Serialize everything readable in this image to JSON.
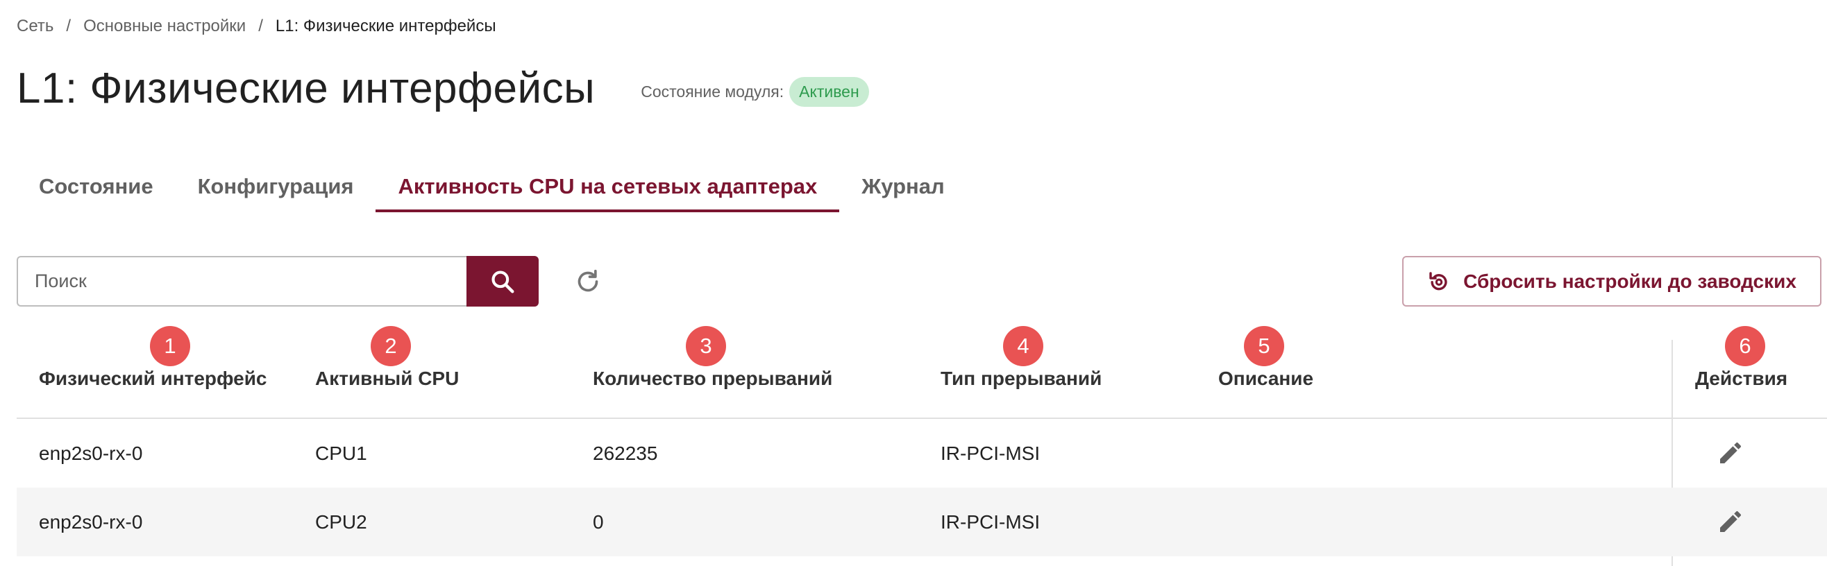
{
  "breadcrumb": {
    "items": [
      "Сеть",
      "Основные настройки",
      "L1: Физические интерфейсы"
    ],
    "separator": "/"
  },
  "page": {
    "title": "L1: Физические интерфейсы",
    "module_state_label": "Состояние модуля:",
    "module_state_value": "Активен"
  },
  "tabs": [
    {
      "label": "Состояние",
      "active": false
    },
    {
      "label": "Конфигурация",
      "active": false
    },
    {
      "label": "Активность CPU на сетевых адаптерах",
      "active": true
    },
    {
      "label": "Журнал",
      "active": false
    }
  ],
  "toolbar": {
    "search_placeholder": "Поиск",
    "search_icon": "search-icon",
    "refresh_icon": "refresh-icon",
    "reset_label": "Сбросить настройки до заводских",
    "reset_icon": "restore-settings-icon"
  },
  "table": {
    "columns": [
      {
        "badge": "1",
        "label": "Физический интерфейс"
      },
      {
        "badge": "2",
        "label": "Активный CPU"
      },
      {
        "badge": "3",
        "label": "Количество прерываний"
      },
      {
        "badge": "4",
        "label": "Тип прерываний"
      },
      {
        "badge": "5",
        "label": "Описание"
      },
      {
        "badge": "6",
        "label": "Действия"
      }
    ],
    "rows": [
      {
        "interface": "enp2s0-rx-0",
        "cpu": "CPU1",
        "interrupts": "262235",
        "type": "IR-PCI-MSI",
        "description": ""
      },
      {
        "interface": "enp2s0-rx-0",
        "cpu": "CPU2",
        "interrupts": "0",
        "type": "IR-PCI-MSI",
        "description": ""
      }
    ],
    "row_action_icon": "edit-icon"
  },
  "colors": {
    "accent": "#7b1530",
    "badge": "#e95353",
    "status_bg": "#c8ecd2",
    "status_text": "#2e9b4e"
  }
}
